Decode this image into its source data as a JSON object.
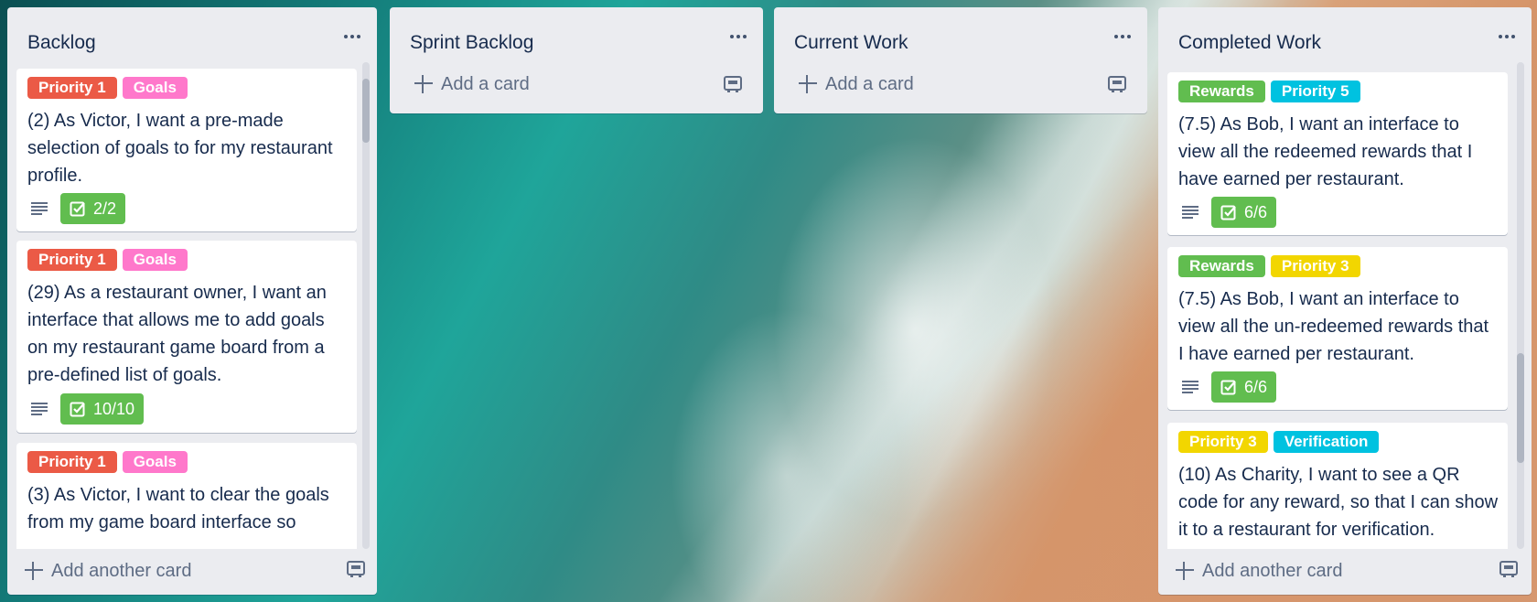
{
  "colors": {
    "green": "#61bd4f",
    "pink": "#ff78cb",
    "red": "#eb5a46",
    "sky": "#00c2e0",
    "yellow": "#f2d600"
  },
  "lists": [
    {
      "title": "Backlog",
      "footer": "Add another card",
      "cards": [
        {
          "labels": [
            {
              "text": "Priority 1",
              "color": "red"
            },
            {
              "text": "Goals",
              "color": "pink"
            }
          ],
          "text": "(2) As Victor, I want a pre-made selection of goals to for my restaurant profile.",
          "checklist": "2/2"
        },
        {
          "labels": [
            {
              "text": "Priority 1",
              "color": "red"
            },
            {
              "text": "Goals",
              "color": "pink"
            }
          ],
          "text": "(29) As a restaurant owner, I want an interface that allows me to add goals on my restaurant game board from a pre-defined list of goals.",
          "checklist": "10/10"
        },
        {
          "labels": [
            {
              "text": "Priority 1",
              "color": "red"
            },
            {
              "text": "Goals",
              "color": "pink"
            }
          ],
          "text": "(3) As Victor, I want to clear the goals from my game board interface so"
        }
      ]
    },
    {
      "title": "Sprint Backlog",
      "footer": "Add a card",
      "cards": []
    },
    {
      "title": "Current Work",
      "footer": "Add a card",
      "cards": []
    },
    {
      "title": "Completed Work",
      "footer": "Add another card",
      "cards": [
        {
          "labels": [
            {
              "text": "Rewards",
              "color": "green"
            },
            {
              "text": "Priority 5",
              "color": "sky"
            }
          ],
          "text": "(7.5) As Bob, I want an interface to view all the redeemed rewards that I have earned per restaurant.",
          "checklist": "6/6"
        },
        {
          "labels": [
            {
              "text": "Rewards",
              "color": "green"
            },
            {
              "text": "Priority 3",
              "color": "yellow"
            }
          ],
          "text": "(7.5) As Bob, I want an interface to view all the un-redeemed rewards that I have earned per restaurant.",
          "checklist": "6/6"
        },
        {
          "labels": [
            {
              "text": "Priority 3",
              "color": "yellow"
            },
            {
              "text": "Verification",
              "color": "sky"
            }
          ],
          "text": "(10) As Charity, I want to see a QR code for any reward, so that I can show it to a restaurant for verification."
        }
      ]
    }
  ]
}
